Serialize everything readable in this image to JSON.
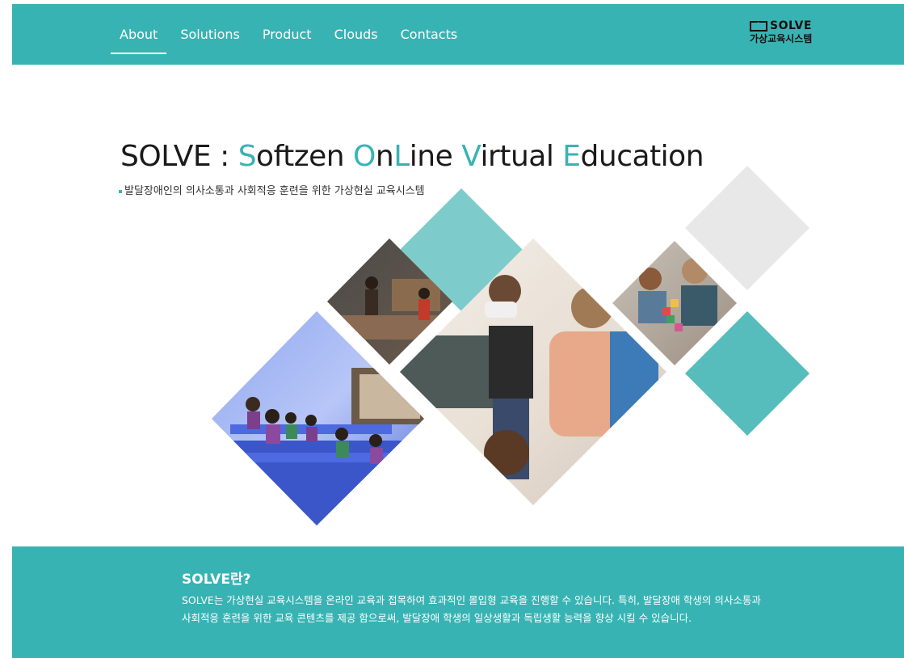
{
  "nav": {
    "items": [
      {
        "label": "About",
        "active": true
      },
      {
        "label": "Solutions",
        "active": false
      },
      {
        "label": "Product",
        "active": false
      },
      {
        "label": "Clouds",
        "active": false
      },
      {
        "label": "Contacts",
        "active": false
      }
    ]
  },
  "logo": {
    "brand": "SOLVE",
    "subtitle": "가상교육시스템"
  },
  "hero": {
    "title_parts": [
      {
        "text": "SOLVE : ",
        "highlight": false
      },
      {
        "text": "S",
        "highlight": true
      },
      {
        "text": "oftzen ",
        "highlight": false
      },
      {
        "text": "O",
        "highlight": true
      },
      {
        "text": "n",
        "highlight": false
      },
      {
        "text": "L",
        "highlight": true
      },
      {
        "text": "ine ",
        "highlight": false
      },
      {
        "text": "V",
        "highlight": true
      },
      {
        "text": "irtual ",
        "highlight": false
      },
      {
        "text": "E",
        "highlight": true
      },
      {
        "text": "ducation",
        "highlight": false
      }
    ],
    "subtitle": "발달장애인의 의사소통과 사회적응 훈련을 위한 가상현실 교육시스템"
  },
  "footer": {
    "title": "SOLVE란?",
    "body": "SOLVE는 가상현실 교육시스템을 온라인 교육과 접목하여 효과적인 몰입형 교육을 진행할 수 있습니다. 특히, 발달장애 학생의 의사소통과 사회적응 훈련을 위한 교육 콘텐츠를 제공 함으로써, 발달장애 학생의 일상생활과 독립생활 능력을 향상 시킬 수 있습니다."
  },
  "colors": {
    "accent": "#38b3b3",
    "diamond_teal": "#7ecbcb",
    "diamond_gray": "#e6e6e6"
  }
}
